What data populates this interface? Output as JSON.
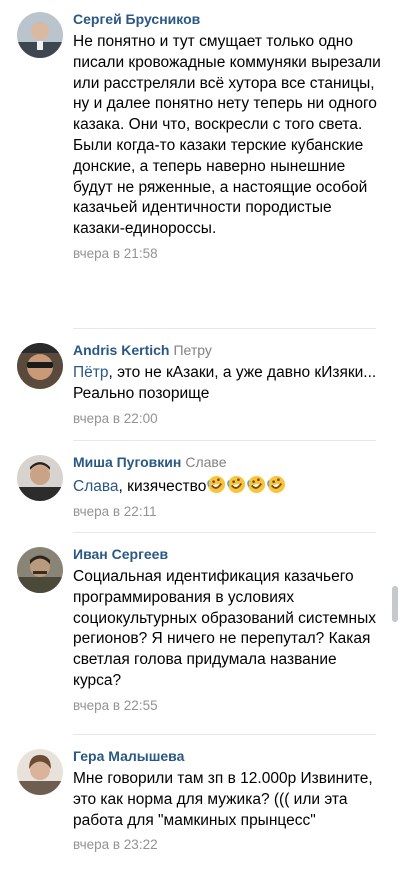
{
  "comments": [
    {
      "author": "Сергей Брусников",
      "reply_to": "",
      "mention": "",
      "text": "Не понятно и тут смущает только одно писали кровожадные коммуняки вырезали или расстреляли всё хутора все станицы, ну и далее понятно нету теперь ни одного казака. Они что, воскресли с того света. Были когда-то казаки терские кубанские донские, а теперь наверно нынешние будут не ряженные, а настоящие особой казачьей идентичности породистые казаки-единороссы.",
      "time": "вчера в 21:58"
    },
    {
      "author": "Andris Kertich",
      "reply_to": "Петру",
      "mention": "Пётр",
      "text": ", это не кАзаки, а уже давно кИзяки... Реально позорище",
      "time": "вчера в 22:00"
    },
    {
      "author": "Миша Пуговкин",
      "reply_to": "Славе",
      "mention": "Слава",
      "text": ", кизячество",
      "emoji": [
        "rolling-on-floor-laughing",
        "rolling-on-floor-laughing",
        "rolling-on-floor-laughing",
        "rolling-on-floor-laughing"
      ],
      "time": "вчера в 22:11"
    },
    {
      "author": "Иван Сергеев",
      "reply_to": "",
      "mention": "",
      "text": "Социальная идентификация казачьего программирования в условиях социокультурных образований системных регионов? Я ничего не перепутал? Какая светлая голова придумала название курса?",
      "time": "вчера в 22:55"
    },
    {
      "author": "Гера Малышева",
      "reply_to": "",
      "mention": "",
      "text": "Мне говорили там зп в 12.000р Извините, это как норма для мужика? ((( или эта работа для \"мамкиных прынцесс\"",
      "time": "вчера в 23:22"
    }
  ]
}
